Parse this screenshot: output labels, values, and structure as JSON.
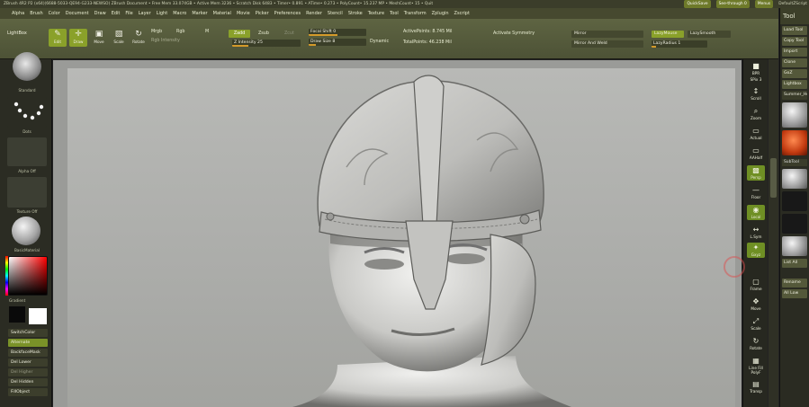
{
  "titlebar": {
    "text": "ZBrush 4R2 P2 (x64)(6688-5033-QE94-G233-NEWSO)   ZBrush Document   • Free Mem 33.074GB • Active Mem 3236 • Scratch Disk 6483 • Timer• 0.891 • ATime• 0.273 • PolyCount• 15.237 MP • MeshCount• 15 • Quit",
    "quicksave": "QuickSave",
    "seethrough": "See-through 0",
    "menus": "Menus",
    "defaultzscript": "DefaultZScript"
  },
  "menu": [
    "Alpha",
    "Brush",
    "Color",
    "Document",
    "Draw",
    "Edit",
    "File",
    "Layer",
    "Light",
    "Macro",
    "Marker",
    "Material",
    "Movie",
    "Picker",
    "Preferences",
    "Render",
    "Stencil",
    "Stroke",
    "Texture",
    "Tool",
    "Transform",
    "Zplugin",
    "Zscript"
  ],
  "shelf": {
    "lightbox": "LightBox",
    "tools": [
      {
        "label": "Edit",
        "icon": "✎",
        "active": true
      },
      {
        "label": "Draw",
        "icon": "✛",
        "active": true
      },
      {
        "label": "Move",
        "icon": "▣",
        "active": false
      },
      {
        "label": "Scale",
        "icon": "▧",
        "active": false
      },
      {
        "label": "Rotate",
        "icon": "↻",
        "active": false
      }
    ],
    "mrgb": "Mrgb",
    "rgb": "Rgb",
    "m": "M",
    "rgb_intensity": "Rgb Intensity",
    "zadd": "Zadd",
    "zsub": "Zsub",
    "zcut": "Zcut",
    "z_intensity": "Z Intensity 25",
    "focal_shift": "Focal Shift 0",
    "draw_size": "Draw Size 8",
    "dynamic": "Dynamic",
    "active_points": "ActivePoints: 8.745 Mil",
    "total_points": "TotalPoints: 46.238 Mil",
    "activate_symmetry": "Activate Symmetry",
    "mirror": "Mirror",
    "mirror_and_weld": "Mirror And Weld",
    "lazymouse": "LazyMouse",
    "lazysmooth": "LazySmooth",
    "lazyradius": "LazyRadius 1"
  },
  "left_tray": {
    "brush_caption": "Standard",
    "stroke_caption": "Dots",
    "alpha_caption": "Alpha Off",
    "texture_caption": "Texture Off",
    "material_caption": "BasicMaterial",
    "gradient_caption": "Gradient",
    "buttons": [
      {
        "label": "SwitchColor",
        "active": false
      },
      {
        "label": "Alternate",
        "active": true
      },
      {
        "label": "BackfaceMask",
        "active": false
      },
      {
        "label": "Del Lower",
        "active": false
      },
      {
        "label": "Del Higher",
        "active": false
      },
      {
        "label": "Del Hidden",
        "active": false
      },
      {
        "label": "FillObject",
        "active": false
      }
    ]
  },
  "right_shelf": [
    {
      "label": "BPR",
      "icon": "■",
      "active": false
    },
    {
      "label": "SPix 3",
      "icon": "",
      "active": false
    },
    {
      "label": "Scroll",
      "icon": "↕",
      "active": false
    },
    {
      "label": "Zoom",
      "icon": "⌕",
      "active": false
    },
    {
      "label": "Actual",
      "icon": "▭",
      "active": false
    },
    {
      "label": "AAHalf",
      "icon": "▭",
      "active": false
    },
    {
      "label": "Persp",
      "icon": "▩",
      "active": true
    },
    {
      "label": "Floor",
      "icon": "—",
      "active": false
    },
    {
      "label": "Local",
      "icon": "◉",
      "active": true
    },
    {
      "label": "L.Sym",
      "icon": "↔",
      "active": false
    },
    {
      "label": "Gxyz",
      "icon": "✦",
      "active": true
    },
    {
      "label": "Frame",
      "icon": "▢",
      "active": false
    },
    {
      "label": "Move",
      "icon": "✥",
      "active": false
    },
    {
      "label": "Scale",
      "icon": "⤢",
      "active": false
    },
    {
      "label": "Rotate",
      "icon": "↻",
      "active": false
    },
    {
      "label": "Line Fill PolyF",
      "icon": "▦",
      "active": false
    },
    {
      "label": "Transp",
      "icon": "▤",
      "active": false
    }
  ],
  "tool_panel": {
    "title": "Tool",
    "buttons_top": [
      "Load Tool",
      "Copy Tool",
      "Import",
      "Clone",
      "GoZ",
      "Lightbox",
      "Summer_Head"
    ],
    "subtool": "SubTool",
    "list_all": "List All",
    "rename": "Rename",
    "all_low": "All Low"
  },
  "colors": {
    "accent": "#8aa12a",
    "shelf": "#565b3c",
    "canvas": "#a9aaa7"
  }
}
